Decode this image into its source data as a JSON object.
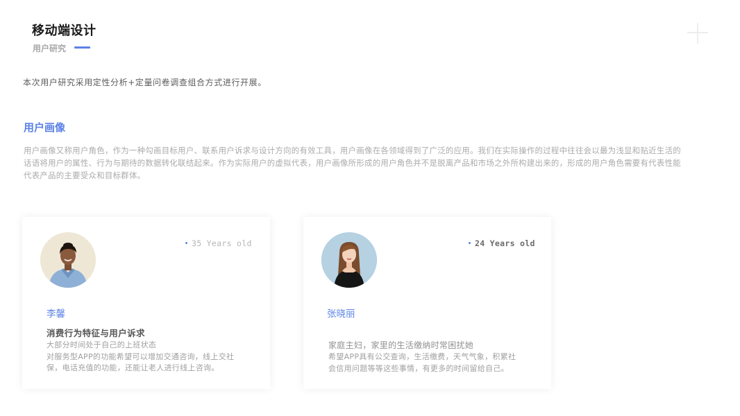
{
  "header": {
    "title": "移动端设计",
    "subtitle": "用户研究",
    "accent_color": "#5b82e6"
  },
  "intro": "本次用户研究采用定性分析+定量问卷调查组合方式进行开展。",
  "section": {
    "heading": "用户画像",
    "description": "用户画像又称用户角色，作为一种勾画目标用户、联系用户诉求与设计方向的有效工具，用户画像在各领域得到了广泛的应用。我们在实际操作的过程中往往会以最为浅显和贴近生活的话语将用户的属性、行为与期待的数据转化联结起来。作为实际用户的虚拟代表，用户画像所形成的用户角色并不是脱离产品和市场之外所构建出来的，形成的用户角色需要有代表性能代表产品的主要受众和目标群体。"
  },
  "personas": [
    {
      "name": "李馨",
      "age": "35 Years old",
      "avatar_icon": "woman-in-blue-uniform",
      "heading": "消费行为特征与用户诉求",
      "lines": [
        "大部分时间处于自己的上班状态",
        "对服务型APP的功能希望可以增加交通咨询，线上交社",
        "保，电话充值的功能，还能让老人进行线上咨询。"
      ]
    },
    {
      "name": "张晓丽",
      "age": "24 Years old",
      "avatar_icon": "woman-in-black-dress",
      "lead": "家庭主妇，家里的生活缴纳时常困扰她",
      "lines": [
        "希望APP具有公交查询，生活缴费，天气气象，积累社",
        "会信用问题等等这些事情，有更多的时间留给自己。"
      ]
    }
  ]
}
